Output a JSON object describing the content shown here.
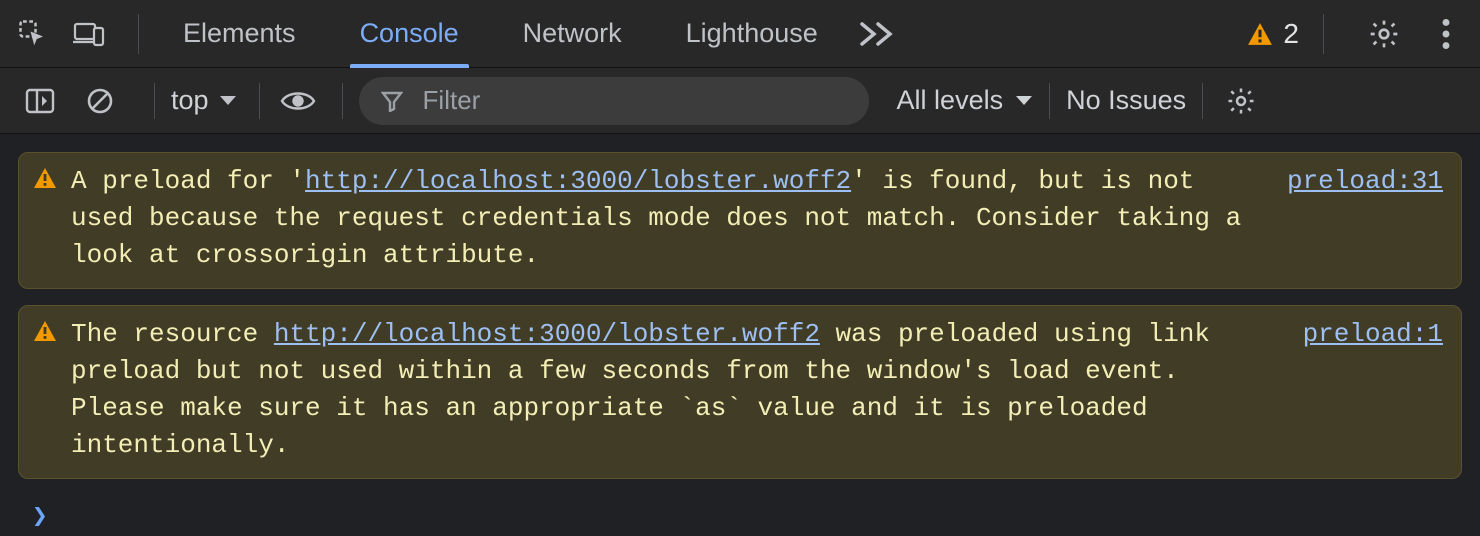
{
  "tabs": [
    "Elements",
    "Console",
    "Network",
    "Lighthouse"
  ],
  "active_tab_index": 1,
  "warning_count": "2",
  "toolbar": {
    "context": "top",
    "filter_placeholder": "Filter",
    "levels_label": "All levels",
    "issues_label": "No Issues"
  },
  "messages": [
    {
      "pre": "A preload for '",
      "url": "http://localhost:3000/lobster.woff2",
      "post": "' is found, but is not used because the request credentials mode does not match. Consider taking a look at crossorigin attribute.",
      "source": "preload:31"
    },
    {
      "pre": "The resource ",
      "url": "http://localhost:3000/lobster.woff2",
      "post": " was preloaded using link preload but not used within a few seconds from the window's load event. Please make sure it has an appropriate `as` value and it is preloaded intentionally.",
      "source": "preload:1"
    }
  ],
  "prompt_symbol": "❯"
}
